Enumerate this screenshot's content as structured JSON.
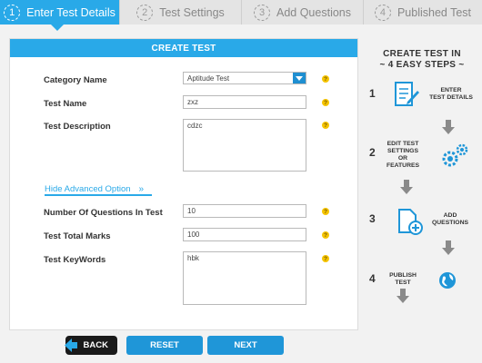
{
  "tabs": [
    {
      "num": "1",
      "label": "Enter Test Details",
      "active": true
    },
    {
      "num": "2",
      "label": "Test Settings",
      "active": false
    },
    {
      "num": "3",
      "label": "Add Questions",
      "active": false
    },
    {
      "num": "4",
      "label": "Published Test",
      "active": false
    }
  ],
  "form": {
    "header": "CREATE TEST",
    "category": {
      "label": "Category Name",
      "value": "Aptitude Test"
    },
    "test_name": {
      "label": "Test Name",
      "value": "zxz"
    },
    "description": {
      "label": "Test Description",
      "value": "cdzc"
    },
    "advanced": {
      "label": "Hide Advanced Option",
      "arrows": "»"
    },
    "num_questions": {
      "label": "Number Of Questions In Test",
      "value": "10"
    },
    "total_marks": {
      "label": "Test Total Marks",
      "value": "100"
    },
    "keywords": {
      "label": "Test KeyWords",
      "value": "hbk"
    },
    "help_glyph": "?"
  },
  "buttons": {
    "back": "BACK",
    "reset": "RESET",
    "next": "NEXT"
  },
  "guide": {
    "title_line1": "CREATE TEST IN",
    "title_line2": "~ 4 EASY STEPS ~",
    "steps": [
      {
        "num": "1",
        "text": "ENTER\nTEST DETAILS",
        "icon": "edit-document-icon"
      },
      {
        "num": "2",
        "text": "EDIT TEST\nSETTINGS\nOR\nFEATURES",
        "icon": "gears-icon"
      },
      {
        "num": "3",
        "text": "ADD\nQUESTIONS",
        "icon": "add-document-icon"
      },
      {
        "num": "4",
        "text": "PUBLISH\nTEST",
        "icon": "globe-icon"
      }
    ]
  },
  "colors": {
    "accent": "#29a9e8",
    "button": "#1f96d8",
    "help": "#f5c400",
    "back": "#1a1a1a"
  }
}
